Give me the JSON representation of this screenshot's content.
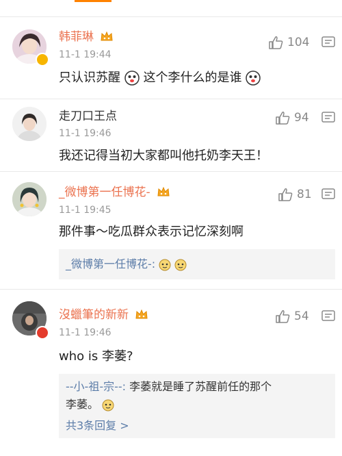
{
  "comments": [
    {
      "name": "韩菲琳",
      "time": "11-1 19:44",
      "text_a": "只认识苏醒",
      "text_b": "这个李什么的是谁",
      "likes": "104",
      "colors": {
        "name": "#eb7350"
      }
    },
    {
      "name": "走刀口王点",
      "time": "11-1 19:46",
      "text": "我还记得当初大家都叫他托奶李天王！",
      "likes": "94"
    },
    {
      "name": "_微博第一任博花-",
      "time": "11-1 19:45",
      "text": "那件事～吃瓜群众表示记忆深刻啊",
      "likes": "81",
      "reply": {
        "name": "_微博第一任博花-:"
      }
    },
    {
      "name": "沒蠟筆的新新",
      "time": "11-1 19:46",
      "text": "who is 李萎?",
      "likes": "54",
      "reply": {
        "name": "--小-祖-宗--:",
        "text_line1": " 李萎就是睡了苏醒前任的那个",
        "text_line2": "李萎。",
        "more": "共3条回复 >"
      }
    }
  ],
  "icons": [
    "thumbs-up-icon",
    "more-icon",
    "crown-badge-icon",
    "emoji-icon",
    "verified-badge-icon"
  ],
  "accent_color": "#ff8200",
  "link_color": "#5b7ca8"
}
